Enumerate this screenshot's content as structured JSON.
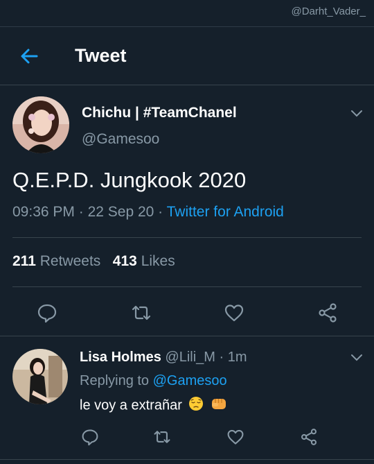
{
  "watermark": "@Darht_Vader_",
  "header": {
    "title": "Tweet"
  },
  "tweet": {
    "author_name": "Chichu | #TeamChanel",
    "author_handle": "@Gamesoo",
    "text": "Q.E.P.D. Jungkook 2020",
    "time": "09:36 PM",
    "dot1": " · ",
    "date": "22 Sep 20",
    "dot2": " · ",
    "source": "Twitter for Android",
    "retweets_count": "211",
    "retweets_label": "Retweets",
    "likes_count": "413",
    "likes_label": "Likes"
  },
  "reply": {
    "author_name": "Lisa Holmes",
    "author_handle": "@Lili_M",
    "dot": " · ",
    "time": "1m",
    "replying_label": "Replying to",
    "replying_to": "@Gamesoo",
    "text": "le voy a extrañar"
  },
  "colors": {
    "background": "#15202b",
    "accent": "#1da1f2",
    "secondary_text": "#8899a6",
    "divider": "#38444d"
  },
  "icons": [
    "back-arrow-icon",
    "chevron-down-icon",
    "reply-icon",
    "retweet-icon",
    "like-icon",
    "share-icon",
    "pensive-face-emoji",
    "fist-emoji"
  ]
}
